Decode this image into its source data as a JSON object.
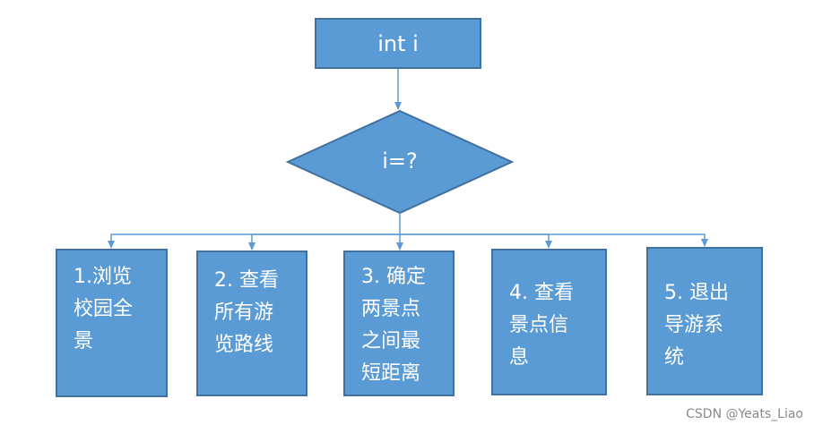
{
  "diagram": {
    "start": "int i",
    "decision": "i=?",
    "options": [
      {
        "id": "browse",
        "lines": "1.浏览\n校园全\n景"
      },
      {
        "id": "routes",
        "lines": "2. 查看\n所有游\n览路线"
      },
      {
        "id": "shortest",
        "lines": "3. 确定\n两景点\n之间最\n短距离"
      },
      {
        "id": "info",
        "lines": "4. 查看\n景点信\n息"
      },
      {
        "id": "exit",
        "lines": "5. 退出\n导游系\n统"
      }
    ],
    "colors": {
      "fill": "#5b9bd5",
      "border": "#41719c",
      "connector": "#5b9bd5",
      "text": "#ffffff"
    }
  },
  "watermark": "CSDN @Yeats_Liao"
}
